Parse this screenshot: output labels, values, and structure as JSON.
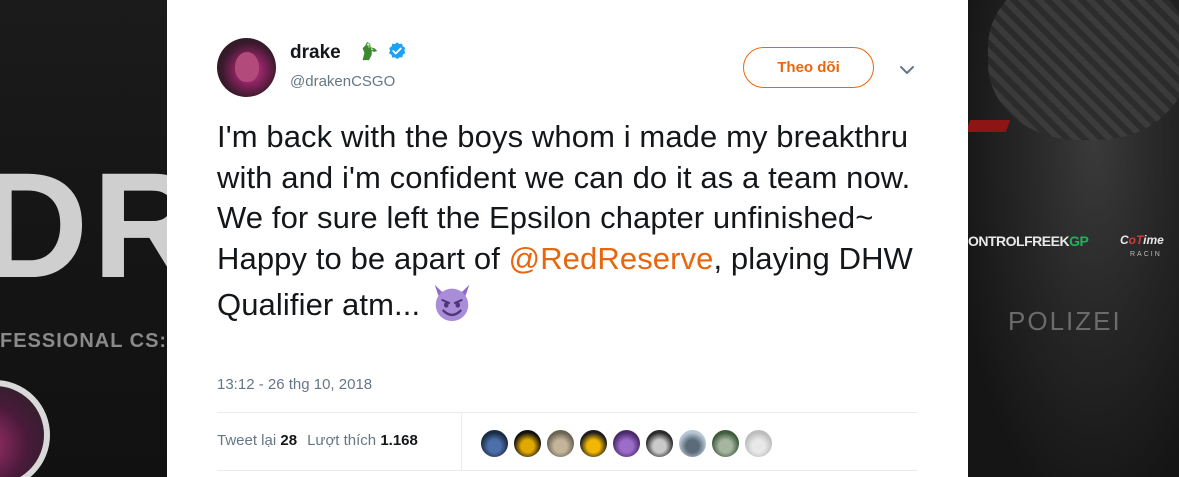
{
  "background": {
    "left_big_text": "DR",
    "left_sub_text": "FESSIONAL CS:",
    "right_sponsor_1_prefix": "ONTROLFREEK",
    "right_sponsor_1_suffix": "GP",
    "right_sponsor_2_prefix": "C",
    "right_sponsor_2_mid": "oT",
    "right_sponsor_2_suffix": "ime",
    "right_sponsor_2_sub": "RACIN",
    "right_mark_text": "POLIZEI"
  },
  "tweet": {
    "display_name": "drake",
    "handle": "@drakenCSGO",
    "follow_label": "Theo dõi",
    "text_part1": "I'm back with the boys whom i made my breakthru with and i'm confident we can do it as a team now. We for sure left the Epsilon chapter unfinished~",
    "text_part2_prefix": "Happy to be apart of ",
    "mention": "@RedReserve",
    "text_part2_suffix": ", playing DHW Qualifier atm... ",
    "timestamp": "13:12 - 26 thg 10, 2018",
    "retweets_label": "Tweet lại",
    "retweets_count": "28",
    "likes_label": "Lượt thích",
    "likes_count": "1.168"
  },
  "icons": {
    "name_emoji": "crocodile-icon",
    "verified": "verified-badge-icon",
    "menu": "chevron-down-icon",
    "text_emoji": "smiling-imp-icon"
  },
  "colors": {
    "accent": "#e8660d",
    "text": "#14171a",
    "secondary": "#657786",
    "verified": "#1da1f2"
  },
  "likers": [
    {
      "name": "liker-avatar-1",
      "bg": "#1a2b45",
      "fg": "#4b6fa8"
    },
    {
      "name": "liker-avatar-2",
      "bg": "#121212",
      "fg": "#e0a800"
    },
    {
      "name": "liker-avatar-3",
      "bg": "#6b6455",
      "fg": "#c4b59a"
    },
    {
      "name": "liker-avatar-4",
      "bg": "#1c1c1c",
      "fg": "#f2b705"
    },
    {
      "name": "liker-avatar-5",
      "bg": "#4b2a6b",
      "fg": "#9b6cc8"
    },
    {
      "name": "liker-avatar-6",
      "bg": "#2a2a2a",
      "fg": "#c9c9c9"
    },
    {
      "name": "liker-avatar-7",
      "bg": "#b7c7d4",
      "fg": "#5a6a78"
    },
    {
      "name": "liker-avatar-8",
      "bg": "#3f5a3f",
      "fg": "#a5b5a0"
    },
    {
      "name": "liker-avatar-9",
      "bg": "#bdbdbd",
      "fg": "#e8e8e8"
    }
  ]
}
